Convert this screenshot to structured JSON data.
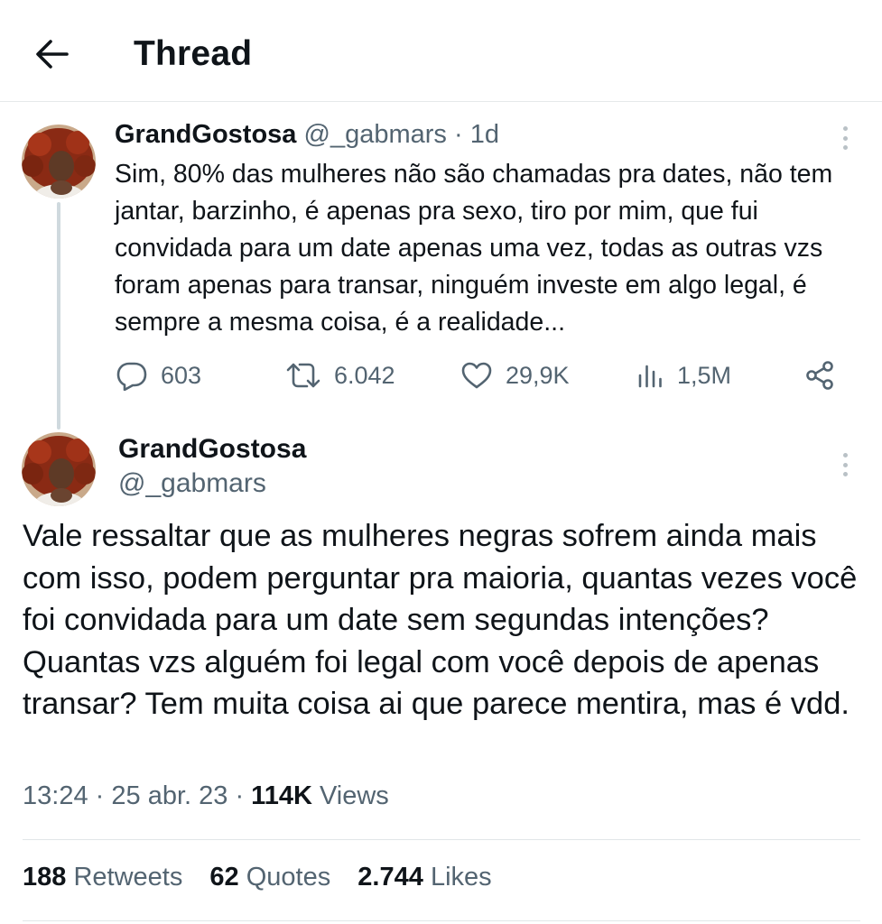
{
  "header": {
    "title": "Thread"
  },
  "parent_tweet": {
    "display_name": "GrandGostosa",
    "handle": "@_gabmars",
    "separator": "·",
    "time_ago": "1d",
    "text": "Sim, 80% das mulheres não são chamadas pra dates, não tem jantar, barzinho, é apenas pra sexo, tiro por mim, que fui convidada para um date apenas uma vez, todas as outras vzs foram apenas para transar, ninguém investe em algo legal, é sempre a mesma coisa, é a realidade...",
    "actions": {
      "replies": "603",
      "retweets": "6.042",
      "likes": "29,9K",
      "views": "1,5M"
    }
  },
  "main_tweet": {
    "display_name": "GrandGostosa",
    "handle": "@_gabmars",
    "text": "Vale ressaltar que as mulheres negras sofrem ainda mais com isso, podem perguntar pra maioria, quantas vezes você foi convidada para um date sem segundas intenções? Quantas vzs alguém foi legal com você depois de apenas transar? Tem muita coisa ai que parece mentira, mas é vdd.",
    "time": "13:24",
    "date": "25 abr. 23",
    "separator": "·",
    "views_count": "114K",
    "views_label": "Views",
    "stats": {
      "retweets_count": "188",
      "retweets_label": "Retweets",
      "quotes_count": "62",
      "quotes_label": "Quotes",
      "likes_count": "2.744",
      "likes_label": "Likes"
    }
  },
  "colors": {
    "text_primary": "#0f1419",
    "text_secondary": "#536471",
    "divider": "#e6e9ea",
    "thread_line": "#cfd9de"
  },
  "icons": [
    "back-arrow-icon",
    "more-options-icon",
    "reply-icon",
    "retweet-icon",
    "like-icon",
    "views-icon",
    "share-icon"
  ]
}
